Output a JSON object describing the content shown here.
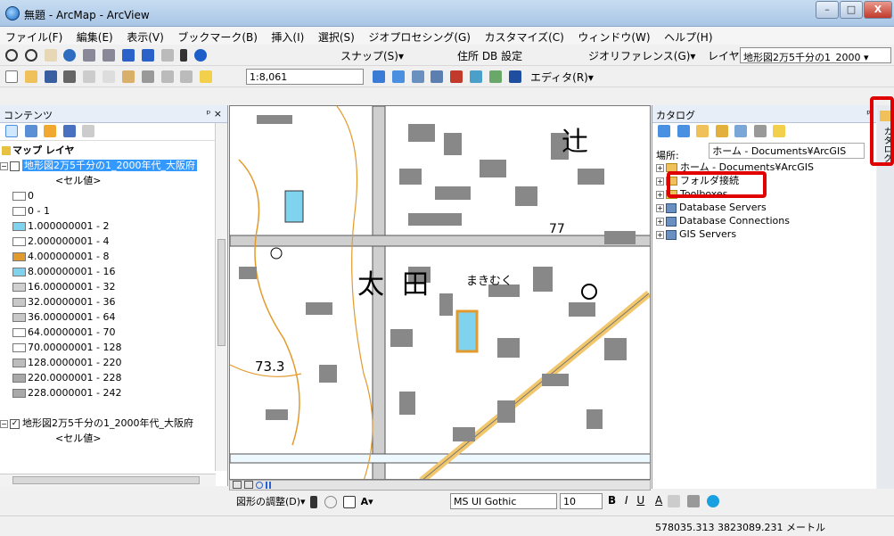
{
  "window": {
    "title": "無題 - ArcMap - ArcView",
    "buttons": {
      "minimize": "–",
      "maximize": "□",
      "close": "X"
    }
  },
  "menu": [
    "ファイル(F)",
    "編集(E)",
    "表示(V)",
    "ブックマーク(B)",
    "挿入(I)",
    "選択(S)",
    "ジオプロセシング(G)",
    "カスタマイズ(C)",
    "ウィンドウ(W)",
    "ヘルプ(H)"
  ],
  "toolbar1": {
    "snap": "スナップ(S)▾",
    "address": "住所 DB 設定",
    "georef": "ジオリファレンス(G)▾",
    "layer_label": "レイヤ:",
    "layer_value": "地形図2万5千分の1_2000"
  },
  "toolbar2": {
    "scale": "1:8,061",
    "editor": "エディタ(R)▾"
  },
  "toc": {
    "header": "コンテンツ",
    "pin": "ᵖ ×",
    "root": "マップ レイヤ",
    "layer1_name": "地形図2万5千分の1_2000年代_大阪府",
    "layer1_field": "<セル値>",
    "legend": [
      {
        "label": "0",
        "color": "#ffffff"
      },
      {
        "label": "0 - 1",
        "color": "#ffffff"
      },
      {
        "label": "1.000000001 - 2",
        "color": "#7fd3ee"
      },
      {
        "label": "2.000000001 - 4",
        "color": "#ffffff"
      },
      {
        "label": "4.000000001 - 8",
        "color": "#e39a2d"
      },
      {
        "label": "8.000000001 - 16",
        "color": "#7fd3ee"
      },
      {
        "label": "16.00000001 - 32",
        "color": "#d0d0d0"
      },
      {
        "label": "32.00000001 - 36",
        "color": "#c8c8c8"
      },
      {
        "label": "36.00000001 - 64",
        "color": "#c8c8c8"
      },
      {
        "label": "64.00000001 - 70",
        "color": "#ffffff"
      },
      {
        "label": "70.00000001 - 128",
        "color": "#ffffff"
      },
      {
        "label": "128.0000001 - 220",
        "color": "#bdbdbd"
      },
      {
        "label": "220.0000001 - 228",
        "color": "#a9a9a9"
      },
      {
        "label": "228.0000001 - 242",
        "color": "#a9a9a9"
      }
    ],
    "layer2_name": "地形図2万5千分の1_2000年代_大阪府",
    "layer2_field": "<セル値>"
  },
  "map": {
    "labels": {
      "town1": "太",
      "town2": "田",
      "kana": "まきむく",
      "elevation": "73.3",
      "num77": "77",
      "tsuji": "辻"
    }
  },
  "catalog": {
    "header": "カタログ",
    "location_label": "場所:",
    "location_value": "ホーム - Documents¥ArcGIS",
    "tree": [
      {
        "label": "ホーム - Documents¥ArcGIS",
        "icon": "folder"
      },
      {
        "label": "フォルダ接続",
        "icon": "folder"
      },
      {
        "label": "Toolboxes",
        "icon": "folder"
      },
      {
        "label": "Database Servers",
        "icon": "db"
      },
      {
        "label": "Database Connections",
        "icon": "db"
      },
      {
        "label": "GIS Servers",
        "icon": "db"
      }
    ],
    "side_tab": "カタログ"
  },
  "draw_toolbar": {
    "drawing": "図形の調整(D)▾",
    "font": "MS UI Gothic",
    "size": "10",
    "bold": "B",
    "italic": "I",
    "underline": "U",
    "fontcolor": "A"
  },
  "status": {
    "coords": "578035.313  3823089.231 メートル"
  },
  "colors": {
    "highlight": "#e00000",
    "water": "#7fd3ee",
    "contour": "#e39a2d"
  }
}
